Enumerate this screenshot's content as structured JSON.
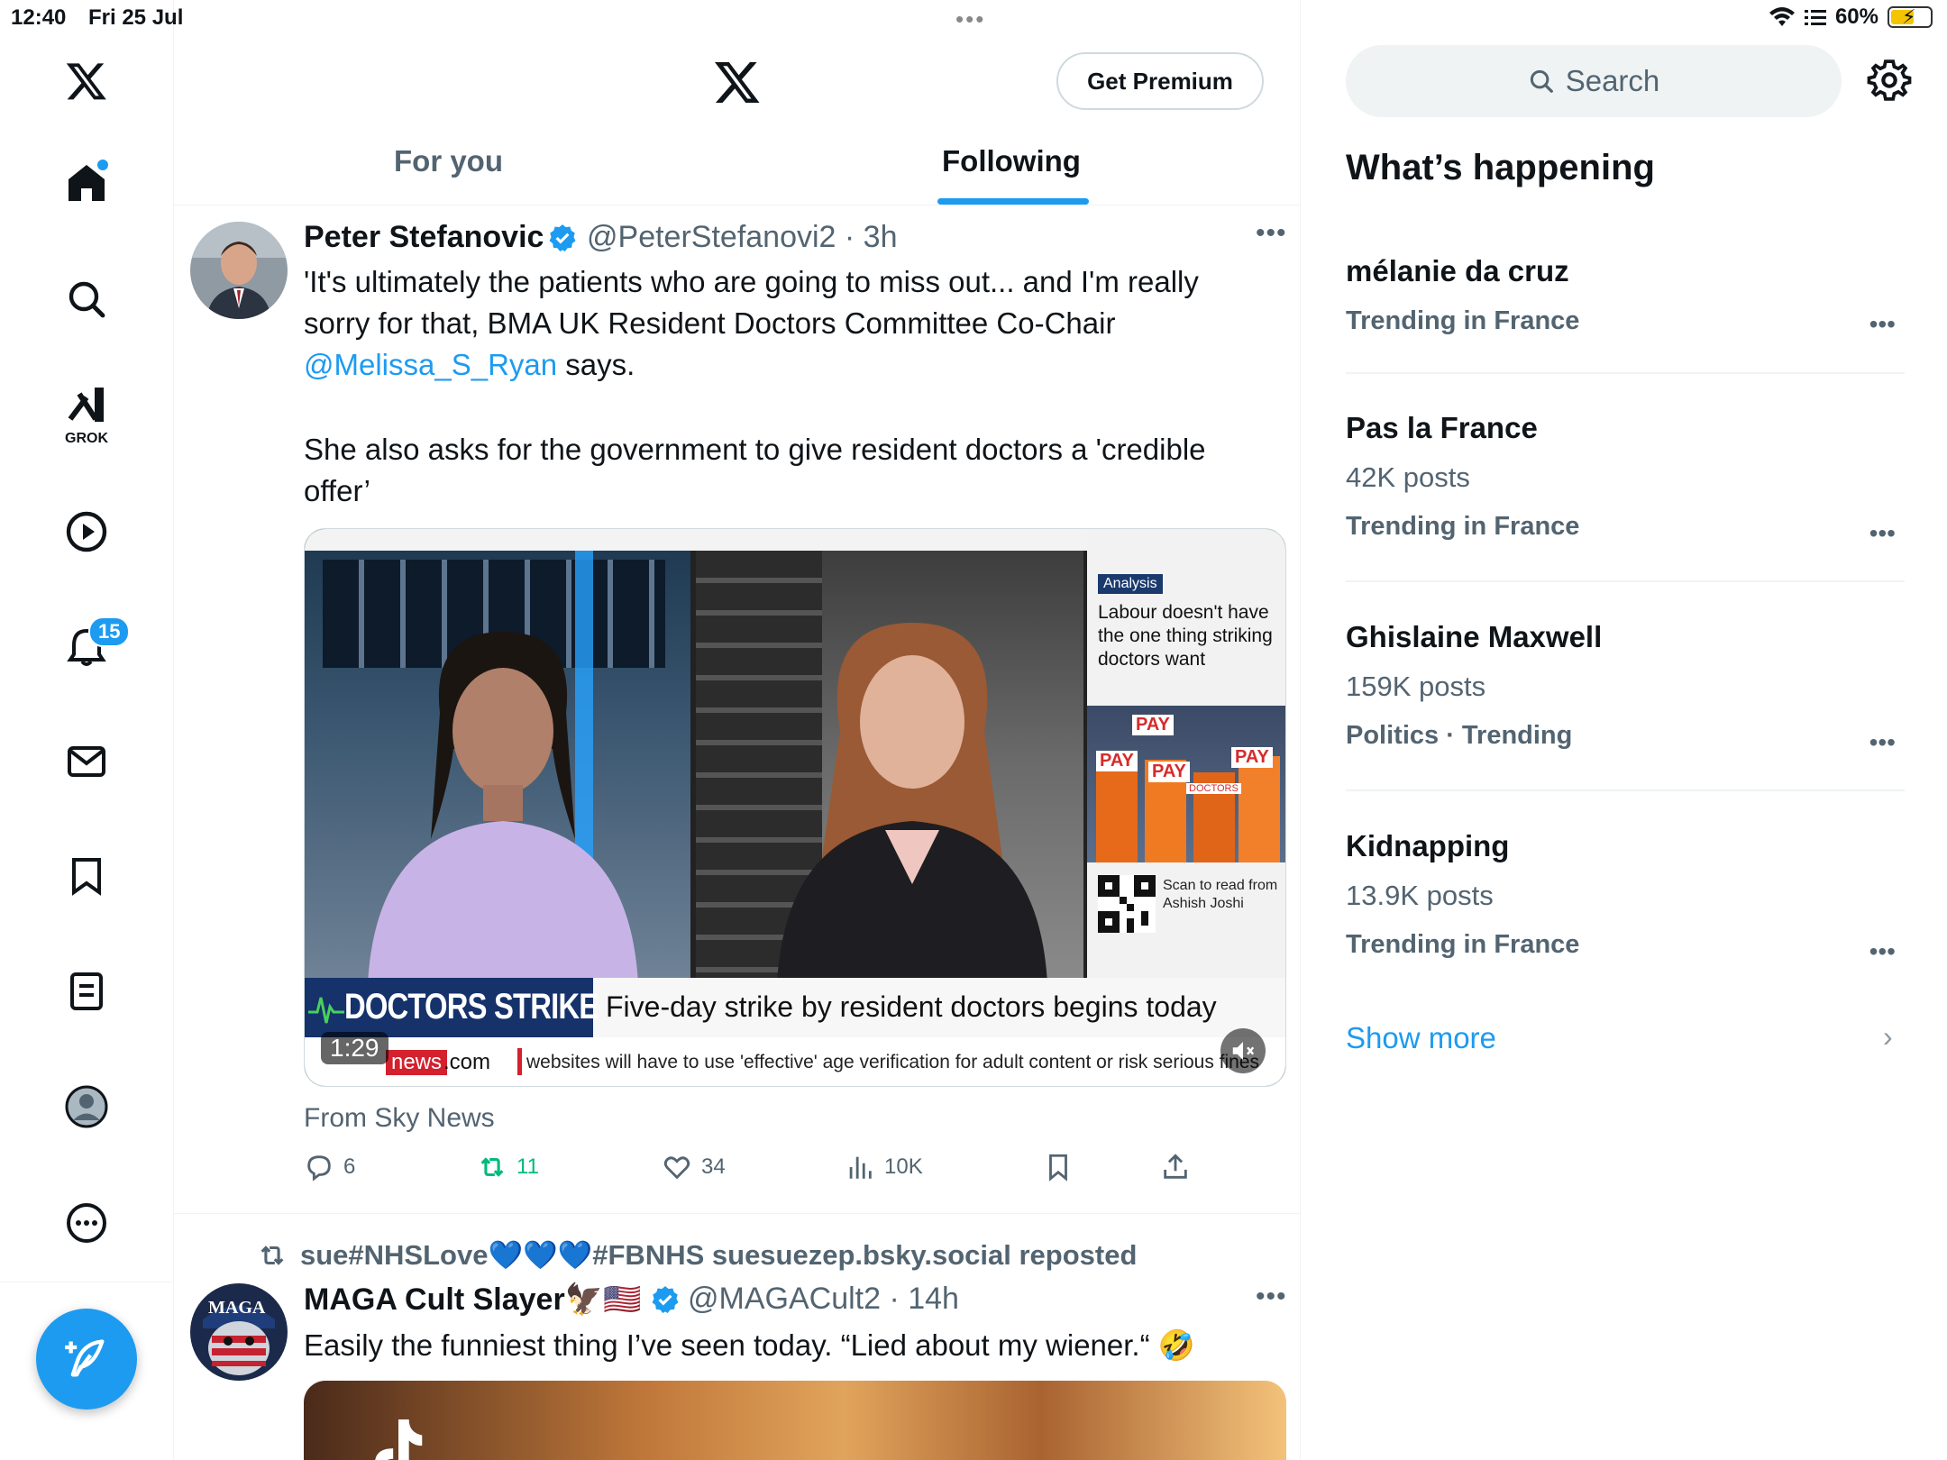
{
  "status_bar": {
    "time": "12:40",
    "date": "Fri 25 Jul",
    "battery": "60%",
    "battery_level": 0.6
  },
  "nav": {
    "items": [
      "x-logo",
      "home",
      "explore",
      "grok",
      "videos",
      "notifications",
      "messages",
      "bookmarks",
      "lists",
      "profile",
      "more"
    ],
    "grok_label": "GROK",
    "notification_count": "15"
  },
  "header": {
    "premium_label": "Get Premium",
    "tabs": [
      {
        "label": "For you",
        "active": false
      },
      {
        "label": "Following",
        "active": true
      }
    ]
  },
  "tweets": [
    {
      "name": "Peter Stefanovic",
      "handle": "@PeterStefanovi2 · 3h",
      "verified": true,
      "text_part1": "'It's ultimately the patients who are going to miss out... and I'm really sorry for that, BMA UK Resident Doctors Committee Co-Chair",
      "mention": "@Melissa_S_Ryan",
      "text_part2": " says.",
      "text_para2": "She also asks for the government to give resident doctors a 'credible offer’",
      "media": {
        "analysis_tag": "Analysis",
        "analysis_text": "Labour doesn't have the one thing striking doctors want",
        "placard_text": "PAY",
        "placard_sub": "DOCTORS",
        "qr_text": "Scan to read from Ashish Joshi",
        "banner_left": "DOCTORS STRIKE",
        "banner_right": "Five-day strike by resident doctors begins today",
        "ticker_brand": "news",
        "ticker_suffix": ".com",
        "ticker_text": "websites will have to use 'effective' age verification for adult content or risk serious fines",
        "duration": "1:29"
      },
      "source": "From Sky News",
      "stats": {
        "replies": "6",
        "reposts": "11",
        "likes": "34",
        "views": "10K"
      }
    },
    {
      "repost_by": "sue#NHSLove💙💙💙#FBNHS suesuezep.bsky.social reposted",
      "name": "MAGA Cult Slayer🦅🇺🇸",
      "handle": "@MAGACult2 · 14h",
      "verified": true,
      "avatar_text": "MAGA",
      "text": "Easily the funniest thing I’ve seen today. “Lied about my wiener.“ 🤣"
    }
  ],
  "sidebar": {
    "search_placeholder": "Search",
    "title": "What’s happening",
    "trends": [
      {
        "name": "mélanie da cruz",
        "posts": "",
        "meta": "Trending in France"
      },
      {
        "name": "Pas la France",
        "posts": "42K posts",
        "meta": "Trending in France"
      },
      {
        "name": "Ghislaine Maxwell",
        "posts": "159K posts",
        "meta": "Politics · Trending"
      },
      {
        "name": "Kidnapping",
        "posts": "13.9K posts",
        "meta": "Trending in France"
      }
    ],
    "show_more": "Show more"
  },
  "colors": {
    "accent": "#1d9bf0",
    "repost_green": "#00ba7c",
    "text_primary": "#0f1419",
    "text_secondary": "#536471"
  }
}
